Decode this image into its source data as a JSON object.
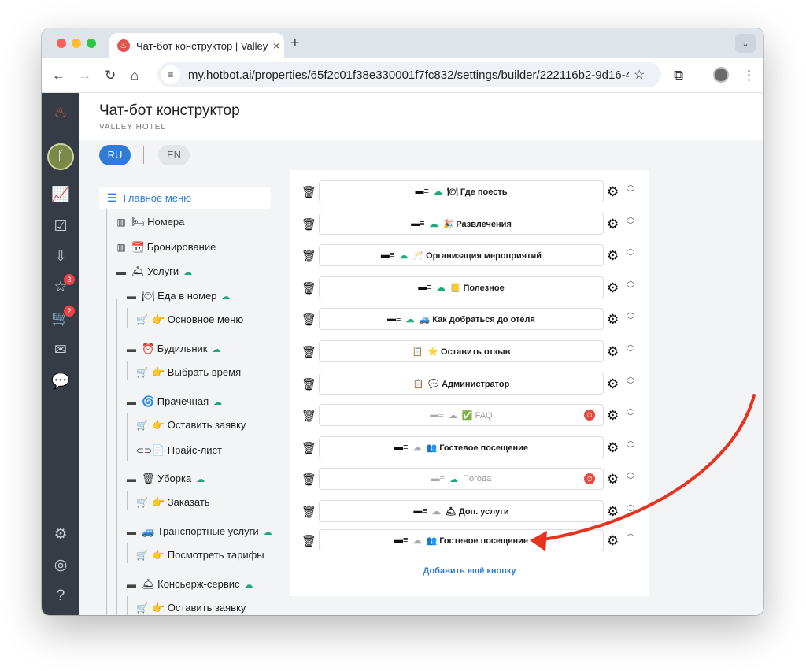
{
  "browser": {
    "tab_title": "Чат-бот конструктор | Valley",
    "tab_close": "×",
    "new_tab": "+",
    "url": "my.hotbot.ai/properties/65f2c01f38e330001f7fc832/settings/builder/222116b2-9d16-4…"
  },
  "header": {
    "title": "Чат-бот конструктор",
    "subtitle": "VALLEY HOTEL"
  },
  "languages": [
    {
      "label": "RU",
      "active": true
    },
    {
      "label": "EN",
      "active": false
    }
  ],
  "sidebar_badges": {
    "favorites": "3",
    "cart": "2"
  },
  "tree": {
    "root": "Главное меню",
    "items": [
      {
        "icon": "chart-icon",
        "label": "🛏 Номера"
      },
      {
        "icon": "chart-icon",
        "label": "📆 Бронирование"
      },
      {
        "icon": "menu-list-icon",
        "label": "🛎 Услуги",
        "cloud": true
      },
      {
        "icon": "menu-list-icon",
        "label": "🍽 Еда в номер",
        "cloud": true
      },
      {
        "icon": "cart-icon",
        "label": "👉 Основное меню"
      },
      {
        "icon": "menu-list-icon",
        "label": "⏰ Будильник",
        "cloud": true
      },
      {
        "icon": "cart-icon",
        "label": "👉 Выбрать время"
      },
      {
        "icon": "menu-list-icon",
        "label": "🌀 Прачечная",
        "cloud": true
      },
      {
        "icon": "cart-icon",
        "label": "👉 Оставить заявку"
      },
      {
        "icon": "link-icon",
        "label": "📄 Прайс-лист"
      },
      {
        "icon": "menu-list-icon",
        "label": "🗑 Уборка",
        "cloud": true
      },
      {
        "icon": "cart-icon",
        "label": "👉 Заказать"
      },
      {
        "icon": "menu-list-icon",
        "label": "🚙 Транспортные услуги",
        "cloud": true
      },
      {
        "icon": "cart-icon",
        "label": "👉 Посмотреть тарифы"
      },
      {
        "icon": "menu-list-icon",
        "label": "🛎 Консьерж-сервис",
        "cloud": true
      },
      {
        "icon": "cart-icon",
        "label": "👉 Оставить заявку"
      }
    ]
  },
  "buttons": [
    {
      "label": "🍽 Где поесть",
      "type": "menu",
      "cloud": "green"
    },
    {
      "label": "🎉 Развлечения",
      "type": "menu",
      "cloud": "green"
    },
    {
      "label": "🥂 Организация мероприятий",
      "type": "menu",
      "cloud": "green"
    },
    {
      "label": "📒 Полезное",
      "type": "menu",
      "cloud": "green"
    },
    {
      "label": "🚙 Как добраться до отеля",
      "type": "menu",
      "cloud": "green"
    },
    {
      "label": "⭐ Оставить отзыв",
      "type": "clipboard"
    },
    {
      "label": "💬 Администратор",
      "type": "clipboard"
    },
    {
      "label": "✅ FAQ",
      "type": "menu",
      "cloud": "gray",
      "disabled": true,
      "timer": true
    },
    {
      "label": "👥 Гостевое посещение",
      "type": "menu",
      "cloud": "gray"
    },
    {
      "label": "Погода",
      "type": "menu",
      "cloud": "green",
      "disabled": true,
      "timer": true
    },
    {
      "label": "🛎 Доп. услуги",
      "type": "menu",
      "cloud": "gray"
    },
    {
      "label": "👥 Гостевое посещение",
      "type": "menu",
      "cloud": "gray",
      "last": true
    }
  ],
  "add_button_label": "Добавить ещё кнопку",
  "colors": {
    "accent": "#2f7bd6",
    "annotation_arrow": "#e8321e",
    "chat_bubble": "#8a9a51"
  }
}
